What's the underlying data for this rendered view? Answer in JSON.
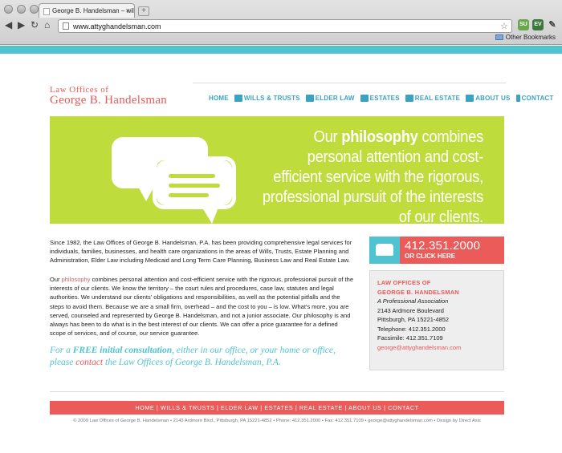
{
  "browser": {
    "tab_title": "George B. Handelsman – will",
    "new_tab_symbol": "+",
    "url": "www.attyghandelsman.com",
    "bookmarks_label": "Other Bookmarks",
    "extensions": [
      "SU",
      "EV"
    ]
  },
  "logo": {
    "line1": "Law Offices of",
    "line2": "George B. Handelsman"
  },
  "nav": [
    {
      "label": "HOME",
      "icon": "none"
    },
    {
      "label": "WILLS & TRUSTS",
      "icon": "scroll-icon"
    },
    {
      "label": "ELDER LAW",
      "icon": "briefcase-icon"
    },
    {
      "label": "ESTATES",
      "icon": "gavel-icon"
    },
    {
      "label": "REAL ESTATE",
      "icon": "building-icon"
    },
    {
      "label": "ABOUT US",
      "icon": "bank-icon"
    },
    {
      "label": "CONTACT",
      "icon": "phone-icon"
    }
  ],
  "hero": {
    "before": "Our ",
    "bold": "philosophy",
    "after": " combines personal attention and cost-efficient service with the rigorous, professional pursuit of the interests of our clients."
  },
  "content": {
    "intro": "Since 1982, the Law Offices of George B. Handelsman, P.A. has been providing comprehensive legal services for individuals, families, businesses, and health care organizations in the areas of Wills, Trusts, Estate Planning and Administration, Elder Law including Medicaid and Long Term Care Planning, Business Law and Real Estate Law.",
    "p2_before": "Our ",
    "p2_highlight": "philosophy",
    "p2_after": " combines personal attention and cost-efficient service with the rigorous, professional pursuit of the interests of our clients. We know the territory – the court rules and procedures, case law, statutes and legal authorities. We understand our clients' obligations and responsibilities, as well as the potential pitfalls and the steps to avoid them. Because we are a small firm, overhead – and the cost to you – is low. What's more, you are served, counseled and represented by George B. Handelsman, and not a junior associate. Our philosophy is and always has been to do what is in the best interest of our clients. We can offer a price guarantee for a defined scope of services, and of course, our service guarantee.",
    "cta_a": "For a ",
    "cta_bold": "FREE initial consultation",
    "cta_b": ", either in our office, or your home or office, please ",
    "cta_link": "contact",
    "cta_c": " the Law Offices of George B. Handelsman, P.A."
  },
  "phone_box": {
    "number": "412.351.2000",
    "cta": "OR CLICK HERE"
  },
  "card": {
    "title1": "LAW OFFICES OF",
    "title2": "GEORGE B. HANDELSMAN",
    "assoc": "A Professional Association",
    "address1": "2143 Ardmore Boulevard",
    "address2": "Pittsburgh, PA 15221-4852",
    "telephone": "Telephone: 412.351.2000",
    "fax": "Facsimile: 412.351.7109",
    "email": "george@attyghandelsman.com"
  },
  "footer": {
    "nav": "HOME | WILLS & TRUSTS | ELDER LAW | ESTATES | REAL ESTATE | ABOUT US | CONTACT",
    "copyright": "© 2009 Law Offices of George B. Handelsman • 2143 Ardmore Blvd., Pittsburgh, PA 15221-4852 • Phone: 412.351.2000 • Fax: 412.351.7109 • george@attyghandelsman.com • Design by Direct Axis"
  },
  "colors": {
    "accent_teal": "#4fc3cf",
    "accent_red": "#ea5b59",
    "accent_lime": "#bedc3c"
  }
}
